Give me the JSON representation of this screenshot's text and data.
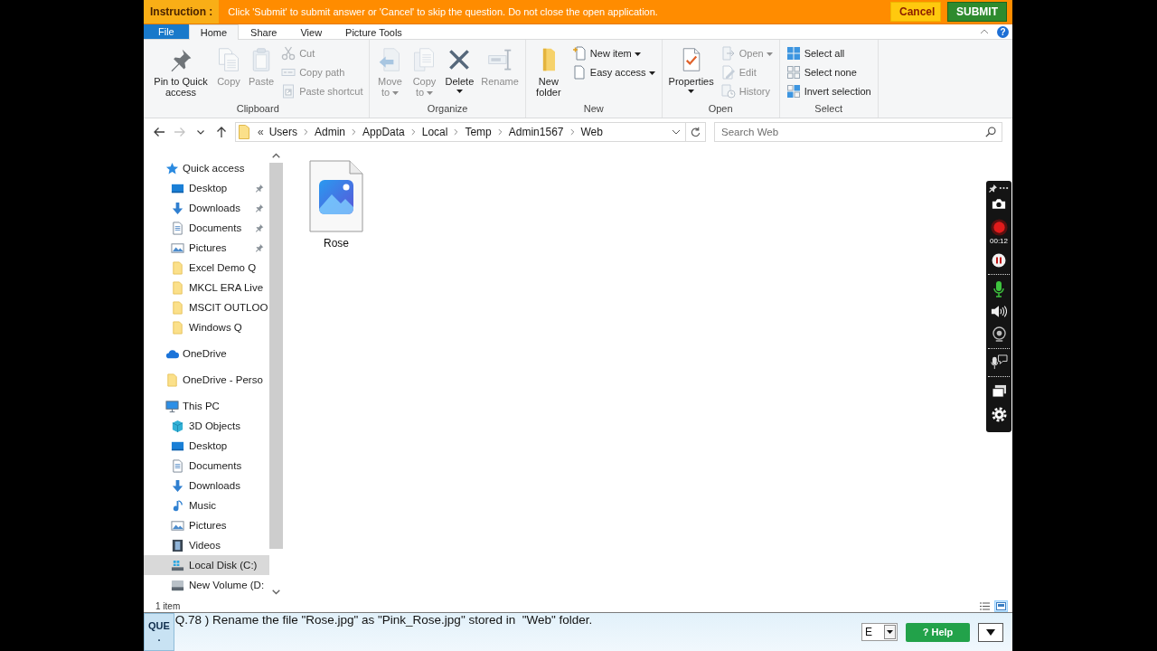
{
  "instruction_bar": {
    "label": "Instruction :",
    "message": "Click 'Submit' to submit answer or 'Cancel' to skip the question. Do not close the open application.",
    "buttons": [
      {
        "label": "Cancel",
        "kind": "cancel"
      },
      {
        "label": "SUBMIT",
        "kind": "submit"
      }
    ]
  },
  "ribbon": {
    "tabs": [
      {
        "label": "File",
        "kind": "file",
        "selected": false
      },
      {
        "label": "Home",
        "kind": "tab",
        "selected": true
      },
      {
        "label": "Share",
        "kind": "tab",
        "selected": false
      },
      {
        "label": "View",
        "kind": "tab",
        "selected": false
      },
      {
        "label": "Picture Tools",
        "kind": "tab",
        "selected": false
      }
    ],
    "help_glyph": "?",
    "groups": [
      {
        "label": "Clipboard",
        "items": [
          {
            "label": "Pin to Quick access",
            "kind": "large",
            "disabled": false,
            "dropdown": false
          },
          {
            "label": "Copy",
            "kind": "large",
            "disabled": true,
            "dropdown": false
          },
          {
            "label": "Paste",
            "kind": "large",
            "disabled": true,
            "dropdown": false
          },
          {
            "label": "Cut",
            "kind": "small",
            "disabled": true,
            "dropdown": false
          },
          {
            "label": "Copy path",
            "kind": "small",
            "disabled": true,
            "dropdown": false
          },
          {
            "label": "Paste shortcut",
            "kind": "small",
            "disabled": true,
            "dropdown": false
          }
        ]
      },
      {
        "label": "Organize",
        "items": [
          {
            "label": "Move to",
            "kind": "large",
            "disabled": true,
            "dropdown": true
          },
          {
            "label": "Copy to",
            "kind": "large",
            "disabled": true,
            "dropdown": true
          },
          {
            "label": "Delete",
            "kind": "large",
            "disabled": false,
            "dropdown": true
          },
          {
            "label": "Rename",
            "kind": "large",
            "disabled": true,
            "dropdown": false
          }
        ]
      },
      {
        "label": "New",
        "items": [
          {
            "label": "New folder",
            "kind": "large",
            "disabled": false,
            "dropdown": false
          },
          {
            "label": "New item",
            "kind": "small",
            "disabled": false,
            "dropdown": true
          },
          {
            "label": "Easy access",
            "kind": "small",
            "disabled": false,
            "dropdown": true
          }
        ]
      },
      {
        "label": "Open",
        "items": [
          {
            "label": "Properties",
            "kind": "large",
            "disabled": false,
            "dropdown": true
          },
          {
            "label": "Open",
            "kind": "small",
            "disabled": true,
            "dropdown": true
          },
          {
            "label": "Edit",
            "kind": "small",
            "disabled": true,
            "dropdown": false
          },
          {
            "label": "History",
            "kind": "small",
            "disabled": true,
            "dropdown": false
          }
        ]
      },
      {
        "label": "Select",
        "items": [
          {
            "label": "Select all",
            "kind": "small",
            "disabled": false,
            "dropdown": false
          },
          {
            "label": "Select none",
            "kind": "small",
            "disabled": false,
            "dropdown": false
          },
          {
            "label": "Invert selection",
            "kind": "small",
            "disabled": false,
            "dropdown": false
          }
        ]
      }
    ]
  },
  "address_bar": {
    "nav_buttons": [
      {
        "disabled": false
      },
      {
        "disabled": true
      },
      {
        "disabled": false
      },
      {
        "disabled": false
      }
    ],
    "overflow": "«",
    "crumbs": [
      "Users",
      "Admin",
      "AppData",
      "Local",
      "Temp",
      "Admin1567",
      "Web"
    ],
    "search": {
      "placeholder": "Search Web"
    }
  },
  "sidebar": {
    "items": [
      {
        "label": "Quick access",
        "selected": false,
        "children": [
          {
            "label": "Desktop",
            "pinned": true,
            "selected": false
          },
          {
            "label": "Downloads",
            "pinned": true,
            "selected": false
          },
          {
            "label": "Documents",
            "pinned": true,
            "selected": false
          },
          {
            "label": "Pictures",
            "pinned": true,
            "selected": false
          },
          {
            "label": "Excel Demo Q",
            "pinned": false,
            "selected": false
          },
          {
            "label": "MKCL ERA Live",
            "pinned": false,
            "selected": false
          },
          {
            "label": "MSCIT OUTLOO",
            "pinned": false,
            "selected": false
          },
          {
            "label": "Windows Q",
            "pinned": false,
            "selected": false
          }
        ]
      },
      {
        "label": "OneDrive",
        "selected": false
      },
      {
        "label": "OneDrive - Perso",
        "selected": false
      },
      {
        "label": "This PC",
        "selected": false,
        "children": [
          {
            "label": "3D Objects",
            "selected": false
          },
          {
            "label": "Desktop",
            "selected": false
          },
          {
            "label": "Documents",
            "selected": false
          },
          {
            "label": "Downloads",
            "selected": false
          },
          {
            "label": "Music",
            "selected": false
          },
          {
            "label": "Pictures",
            "selected": false
          },
          {
            "label": "Videos",
            "selected": false
          },
          {
            "label": "Local Disk (C:)",
            "selected": true
          },
          {
            "label": "New Volume (D:",
            "selected": false
          }
        ]
      }
    ]
  },
  "files": [
    {
      "name": "Rose",
      "selected": false
    }
  ],
  "recorder": {
    "timer": "00:12"
  },
  "status_bar": {
    "item_count": "1 item",
    "views": [
      {
        "kind": "details",
        "selected": false
      },
      {
        "kind": "large_icons",
        "selected": true
      }
    ]
  },
  "question_bar": {
    "label": "QUE .",
    "text": "Q.78 ) Rename the file \"Rose.jpg\" as \"Pink_Rose.jpg\" stored in  \"Web\" folder.",
    "language": "E",
    "help": "? Help"
  }
}
